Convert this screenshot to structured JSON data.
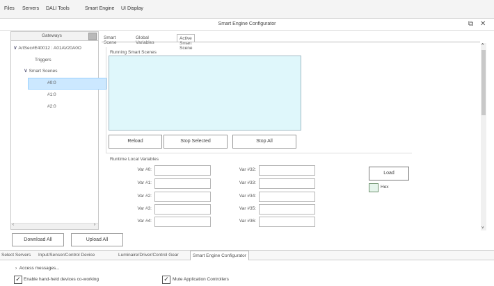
{
  "menu": [
    "Files",
    "Servers",
    "DALI Tools",
    "Smart Engine",
    "UI Display"
  ],
  "window": {
    "title": "Smart Engine Configurator",
    "restore_icon": "restore-icon",
    "close_icon": "close-icon"
  },
  "gateways": {
    "header": "Gateways",
    "tree": {
      "root": "ArtSec#E40012 : A01AV20A0O",
      "triggers": "Triggers",
      "smart_scenes": "Smart Scenes",
      "scenes": [
        "#0:0",
        "#1:0",
        "#2:0"
      ]
    },
    "selected_scene": "#0:0"
  },
  "tabs": [
    "Smart Scene",
    "Global Variables",
    "Active Smart Scene"
  ],
  "active_tab": "Active Smart Scene",
  "running": {
    "label": "Running Smart Scenes",
    "buttons": {
      "reload": "Reload",
      "stop_selected": "Stop Selected",
      "stop_all": "Stop All"
    }
  },
  "runtime": {
    "label": "Runtime Local Variables",
    "vars_left": [
      {
        "label": "Var #0:",
        "value": ""
      },
      {
        "label": "Var #1:",
        "value": ""
      },
      {
        "label": "Var #2:",
        "value": ""
      },
      {
        "label": "Var #3:",
        "value": ""
      },
      {
        "label": "Var #4:",
        "value": ""
      }
    ],
    "vars_right": [
      {
        "label": "Var #32:",
        "value": ""
      },
      {
        "label": "Var #33:",
        "value": ""
      },
      {
        "label": "Var #34:",
        "value": ""
      },
      {
        "label": "Var #35:",
        "value": ""
      },
      {
        "label": "Var #36:",
        "value": ""
      }
    ],
    "load_label": "Load",
    "hex_label": "Hex"
  },
  "bottom_buttons": {
    "download": "Download All",
    "upload": "Upload All"
  },
  "bottom_tabs": [
    "Select Servers",
    "Input/Sensor/Control Device",
    "Luminaire/Driver/Control Gear",
    "Smart Engine Configurator"
  ],
  "active_bottom_tab": "Smart Engine Configurator",
  "status": {
    "access_messages": "Access messages...",
    "enable_hand_held": "Enable hand-held devices co-working",
    "mute_controllers": "Mute Application Controllers",
    "enable_hand_held_checked": true,
    "mute_controllers_checked": true
  },
  "colors": {
    "running_box_bg": "#dff7fb",
    "selection": "#cce8ff"
  }
}
